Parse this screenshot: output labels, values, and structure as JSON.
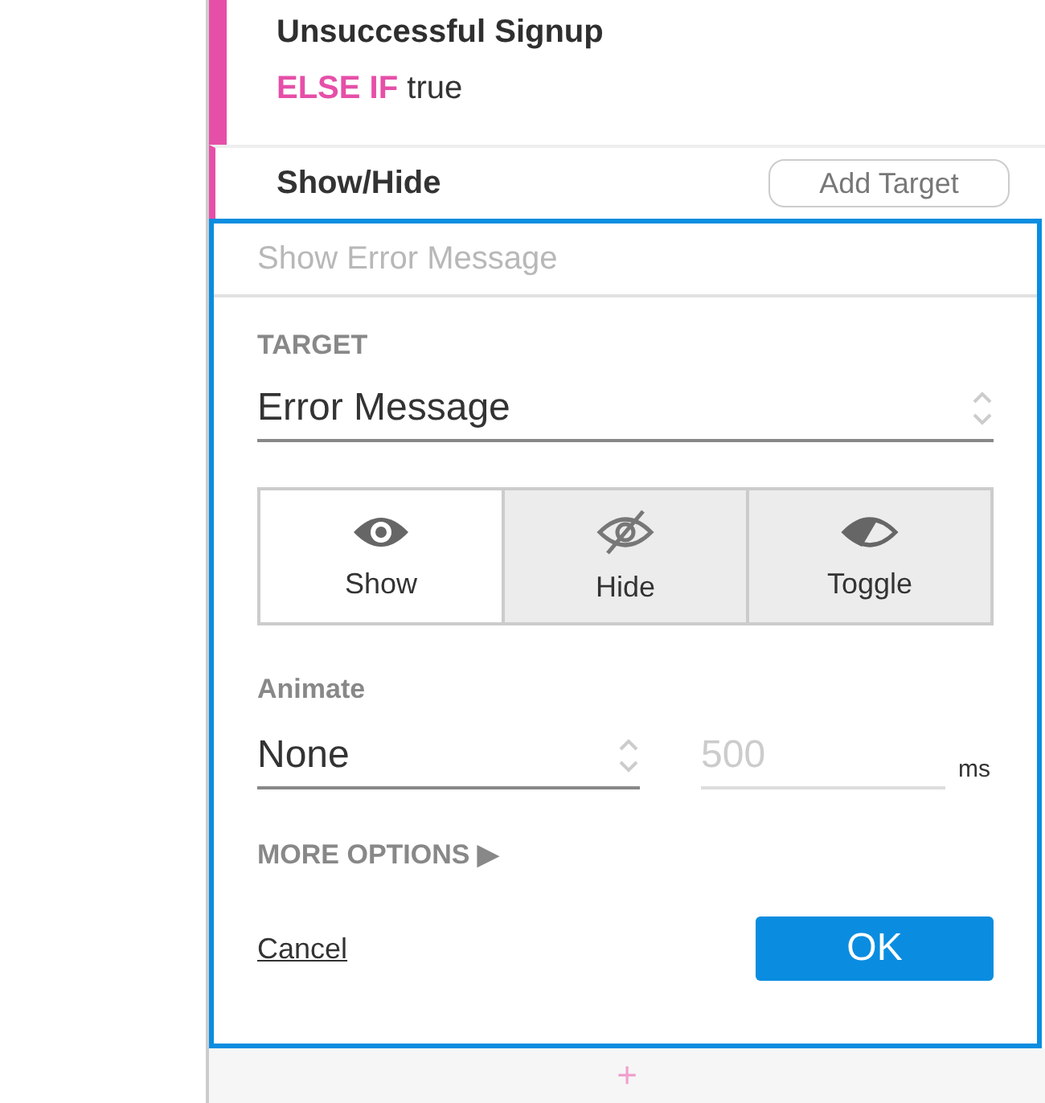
{
  "condition": {
    "title": "Unsuccessful Signup",
    "keyword": "ELSE IF",
    "expression": "true"
  },
  "action": {
    "title": "Show/Hide",
    "add_button": "Add Target"
  },
  "editor": {
    "name_field": {
      "placeholder": "Show Error Message"
    },
    "target": {
      "label": "TARGET",
      "value": "Error Message"
    },
    "modes": [
      {
        "kind": "show",
        "label": "Show",
        "selected": true
      },
      {
        "kind": "hide",
        "label": "Hide",
        "selected": false
      },
      {
        "kind": "toggle",
        "label": "Toggle",
        "selected": false
      }
    ],
    "animate": {
      "label": "Animate",
      "value": "None",
      "duration": {
        "placeholder": "500",
        "unit": "ms"
      }
    },
    "more_options": "MORE OPTIONS ▶",
    "cancel": "Cancel",
    "ok": "OK"
  },
  "add_step": "+"
}
